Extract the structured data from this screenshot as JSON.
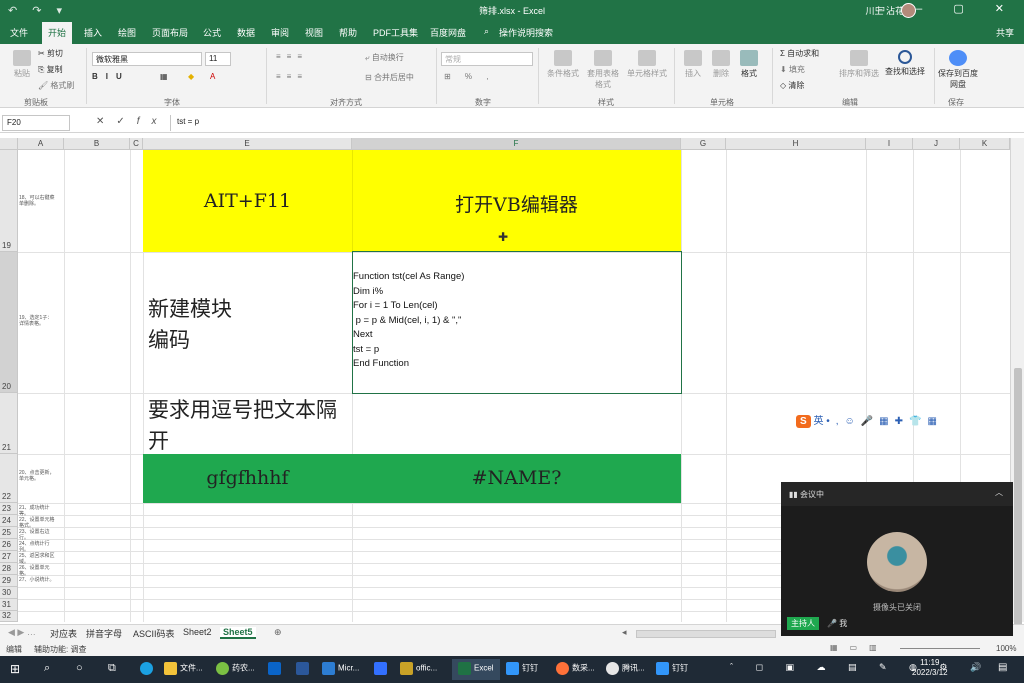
{
  "titlebar": {
    "quick_access": "↶ ↷ ▾",
    "title": "筛排.xlsx - Excel",
    "user": "川上 沾花",
    "window_buttons": "▭ – ▢ ✕"
  },
  "tabs": [
    "文件",
    "开始",
    "插入",
    "绘图",
    "页面布局",
    "公式",
    "数据",
    "审阅",
    "视图",
    "帮助",
    "PDF工具集",
    "百度网盘",
    "操作说明搜索"
  ],
  "share": "共享",
  "ribbon": {
    "paste": "粘贴",
    "cut": "剪切",
    "copy": "复制",
    "format_painter": "格式刷",
    "font_name": "微软雅黑",
    "font_size": "11",
    "wrap": "自动换行",
    "merge": "合并后居中",
    "number_format": "常规",
    "cond_format": "条件格式",
    "table_format": "套用表格格式",
    "cell_style": "单元格样式",
    "insert": "插入",
    "delete": "删除",
    "format": "格式",
    "autosum": "自动求和",
    "fill": "填充",
    "clear": "清除",
    "sort": "排序和筛选",
    "find": "查找和选择",
    "save_baidu": "保存到百度网盘",
    "groups": [
      "剪贴板",
      "字体",
      "对齐方式",
      "数字",
      "样式",
      "单元格",
      "编辑",
      "保存"
    ]
  },
  "formula_bar": {
    "name_box": "F20",
    "fx": "fx",
    "formula": "tst = p"
  },
  "columns": [
    "A",
    "B",
    "C",
    "E",
    "F",
    "G",
    "H",
    "I",
    "J",
    "K"
  ],
  "rows": [
    "19",
    "20",
    "21",
    "22",
    "23",
    "24",
    "25",
    "26",
    "27",
    "28",
    "29",
    "30",
    "31",
    "32"
  ],
  "cells": {
    "e19": "AIT+F11",
    "f19": "打开VB编辑器",
    "e20": "新建模块编码",
    "e21": "要求用逗号把文本隔开",
    "e22": "gfgfhhhf",
    "f22": "#NAME?"
  },
  "vba_code": [
    "Function tst(cel As Range)",
    "Dim i%",
    "For i = 1 To Len(cel)",
    " p = p & Mid(cel, i, 1) & \",\"",
    "Next",
    "tst = p",
    "End Function"
  ],
  "tiny_notes": [
    "18、可以右键菜单删除。",
    "19、选定1子：详情表格。",
    "20、点击更新，单元格。",
    "21、成功统计等。",
    "22、设置单元格格式。",
    "23、设置右边行。",
    "24、点统计行列。",
    "25、返回求和区域。",
    "26、设置单元格。",
    "27、小说统计。"
  ],
  "sheets": [
    "对应表",
    "拼音字母",
    "ASCII码表",
    "Sheet2",
    "Sheet5"
  ],
  "active_sheet": "Sheet5",
  "status": {
    "mode": "编辑",
    "accessibility": "辅助功能: 调查",
    "zoom": "100%"
  },
  "meeting": {
    "status": "会议中",
    "camera_off": "摄像头已关闭",
    "host_tag": "主持人",
    "me": "我"
  },
  "ime": {
    "lang": "英"
  },
  "taskbar": {
    "apps": [
      "文件...",
      "药农...",
      "Micr...",
      "offic...",
      "Excel",
      "钉钉",
      "数采...",
      "腾讯...",
      "钉钉"
    ],
    "time": "11:19",
    "date": "2022/3/12"
  },
  "colors": {
    "excel_green": "#217346",
    "cell_yellow": "#ffff00",
    "cell_green": "#1fa84f"
  }
}
